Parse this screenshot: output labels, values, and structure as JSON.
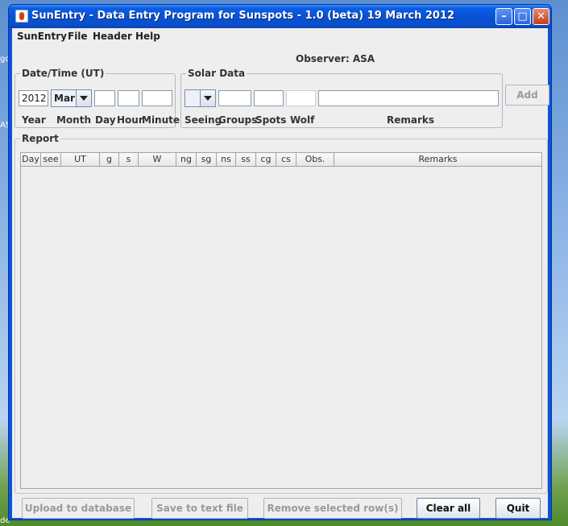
{
  "window": {
    "title": "SunEntry - Data Entry Program for Sunspots  - 1.0 (beta) 19 March 2012"
  },
  "menu": [
    "SunEntry",
    "File",
    "Header",
    "Help"
  ],
  "observer": "Observer: ASA",
  "datetime": {
    "legend": "Date/Time (UT)",
    "year_value": "2012",
    "month_value": "Mar",
    "day_value": "",
    "hour_value": "",
    "minute_value": "",
    "labels": {
      "year": "Year",
      "month": "Month",
      "day": "Day",
      "hour": "Hour",
      "minute": "Minute"
    }
  },
  "solar": {
    "legend": "Solar Data",
    "seeing_value": "",
    "groups_value": "",
    "spots_value": "",
    "wolf_value": "",
    "remarks_value": "",
    "labels": {
      "seeing": "Seeing",
      "groups": "Groups",
      "spots": "Spots",
      "wolf": "Wolf",
      "remarks": "Remarks"
    }
  },
  "add_label": "Add",
  "report": {
    "legend": "Report",
    "columns": [
      "Day",
      "see",
      "UT",
      "g",
      "s",
      "W",
      "ng",
      "sg",
      "ns",
      "ss",
      "cg",
      "cs",
      "Obs.",
      "Remarks"
    ]
  },
  "buttons": {
    "upload": "Upload to database",
    "save": "Save to text file",
    "remove": "Remove selected row(s)",
    "clear": "Clear all",
    "quit": "Quit"
  },
  "desktop_fragments": [
    "go",
    "AS",
    "de"
  ],
  "colors": {
    "titlebar": "#0752d6",
    "client_bg": "#eeeeee",
    "close_button": "#c43e1c"
  }
}
